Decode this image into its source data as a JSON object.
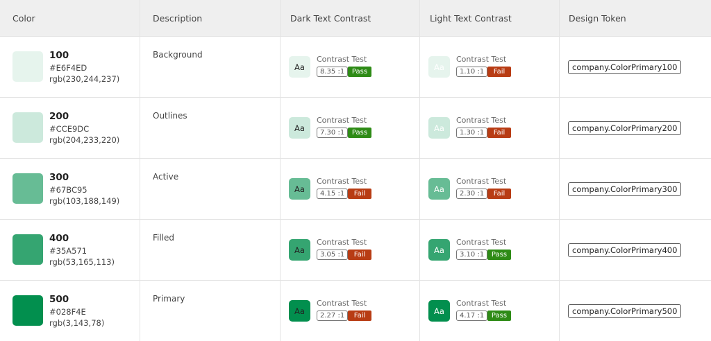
{
  "headers": [
    "Color",
    "Description",
    "Dark Text Contrast",
    "Light Text Contrast",
    "Design Token"
  ],
  "colors": {
    "pass": "#2e8b16",
    "fail": "#b83c14",
    "dark_text": "#222222",
    "light_text": "#ffffff"
  },
  "rows": [
    {
      "shade": "100",
      "hex": "#E6F4ED",
      "rgb": "rgb(230,244,237)",
      "swatch": "#E6F4ED",
      "description": "Background",
      "dark": {
        "sample": "Aa",
        "label": "Contrast Test",
        "ratio": "8.35 :1",
        "result": "Pass"
      },
      "light": {
        "sample": "Aa",
        "label": "Contrast Test",
        "ratio": "1.10 :1",
        "result": "Fail"
      },
      "token": "company.ColorPrimary100"
    },
    {
      "shade": "200",
      "hex": "#CCE9DC",
      "rgb": "rgb(204,233,220)",
      "swatch": "#CCE9DC",
      "description": "Outlines",
      "dark": {
        "sample": "Aa",
        "label": "Contrast Test",
        "ratio": "7.30 :1",
        "result": "Pass"
      },
      "light": {
        "sample": "Aa",
        "label": "Contrast Test",
        "ratio": "1.30 :1",
        "result": "Fail"
      },
      "token": "company.ColorPrimary200"
    },
    {
      "shade": "300",
      "hex": "#67BC95",
      "rgb": "rgb(103,188,149)",
      "swatch": "#67BC95",
      "description": "Active",
      "dark": {
        "sample": "Aa",
        "label": "Contrast Test",
        "ratio": "4.15 :1",
        "result": "Fail"
      },
      "light": {
        "sample": "Aa",
        "label": "Contrast Test",
        "ratio": "2.30 :1",
        "result": "Fail"
      },
      "token": "company.ColorPrimary300"
    },
    {
      "shade": "400",
      "hex": "#35A571",
      "rgb": "rgb(53,165,113)",
      "swatch": "#35A571",
      "description": "Filled",
      "dark": {
        "sample": "Aa",
        "label": "Contrast Test",
        "ratio": "3.05 :1",
        "result": "Fail"
      },
      "light": {
        "sample": "Aa",
        "label": "Contrast Test",
        "ratio": "3.10 :1",
        "result": "Pass"
      },
      "token": "company.ColorPrimary400"
    },
    {
      "shade": "500",
      "hex": "#028F4E",
      "rgb": "rgb(3,143,78)",
      "swatch": "#028F4E",
      "description": "Primary",
      "dark": {
        "sample": "Aa",
        "label": "Contrast Test",
        "ratio": "2.27 :1",
        "result": "Fail"
      },
      "light": {
        "sample": "Aa",
        "label": "Contrast Test",
        "ratio": "4.17 :1",
        "result": "Pass"
      },
      "token": "company.ColorPrimary500"
    }
  ]
}
